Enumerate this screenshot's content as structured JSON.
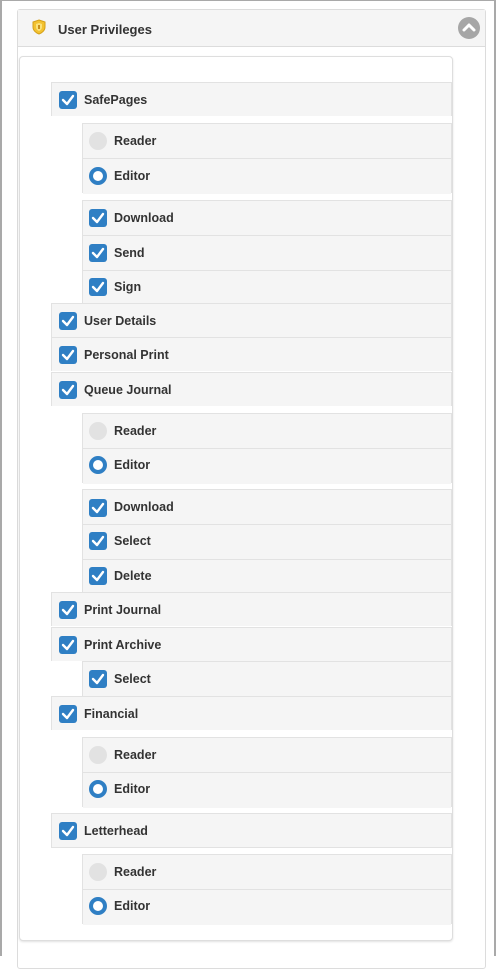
{
  "panel": {
    "title": "User Privileges",
    "accent": "#2f7fc4",
    "icon": "shield-icon"
  },
  "safepages": {
    "label": "SafePages",
    "role_reader": "Reader",
    "role_editor": "Editor",
    "download": "Download",
    "send": "Send",
    "sign": "Sign"
  },
  "user_details": {
    "label": "User Details"
  },
  "personal_print": {
    "label": "Personal Print"
  },
  "queue_journal": {
    "label": "Queue Journal",
    "role_reader": "Reader",
    "role_editor": "Editor",
    "download": "Download",
    "select": "Select",
    "delete": "Delete"
  },
  "print_journal": {
    "label": "Print Journal"
  },
  "print_archive": {
    "label": "Print Archive",
    "select": "Select"
  },
  "financial": {
    "label": "Financial",
    "role_reader": "Reader",
    "role_editor": "Editor"
  },
  "letterhead": {
    "label": "Letterhead",
    "role_reader": "Reader",
    "role_editor": "Editor"
  }
}
